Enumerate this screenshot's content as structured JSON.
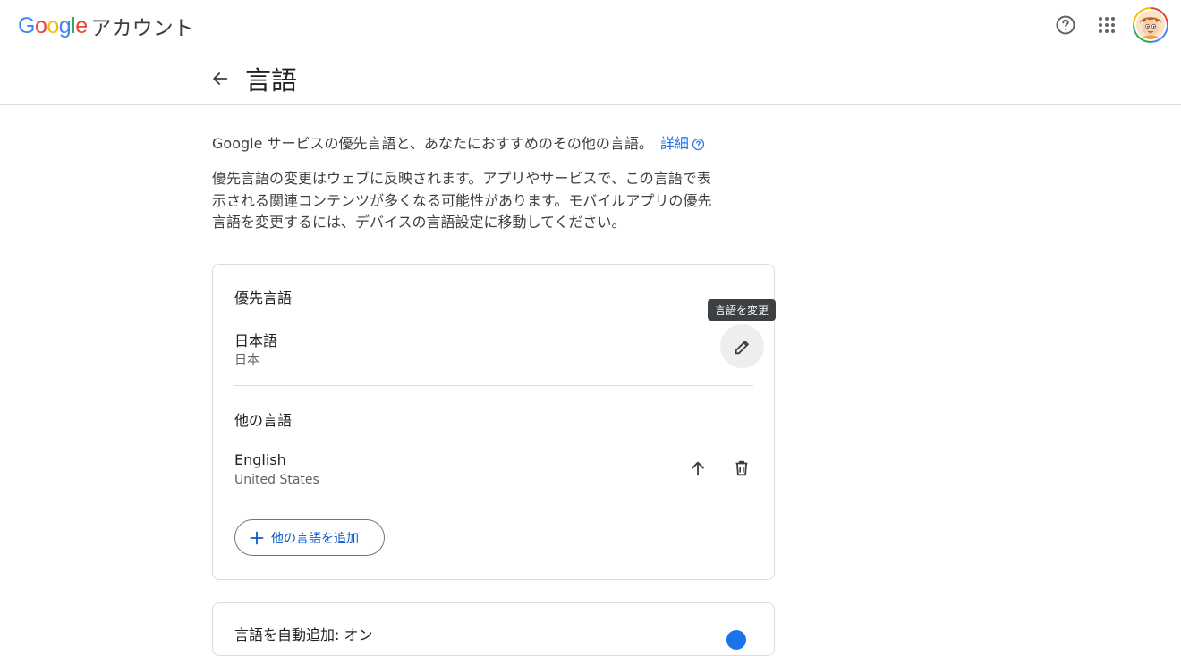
{
  "header": {
    "logo_text": "Google",
    "product_name": "アカウント",
    "help_icon": "help-circle-icon",
    "apps_icon": "apps-grid-icon",
    "avatar_icon": "account-avatar"
  },
  "page": {
    "title": "言語",
    "back_icon": "arrow-back-icon"
  },
  "intro": {
    "text": "Google サービスの優先言語と、あなたにおすすめのその他の言語。",
    "link_label": "詳細",
    "paragraph": "優先言語の変更はウェブに反映されます。アプリやサービスで、この言語で表示される関連コンテンツが多くなる可能性があります。モバイルアプリの優先言語を変更するには、デバイスの言語設定に移動してください。"
  },
  "preferred": {
    "section_title": "優先言語",
    "language": "日本語",
    "region": "日本",
    "edit_tooltip": "言語を変更"
  },
  "other": {
    "section_title": "他の言語",
    "language": "English",
    "region": "United States",
    "add_button_label": "他の言語を追加"
  },
  "auto_add": {
    "title": "言語を自動追加: オン"
  },
  "colors": {
    "accent": "#1a73e8",
    "link_button_text": "#0b57d0",
    "border": "#dadce0"
  }
}
